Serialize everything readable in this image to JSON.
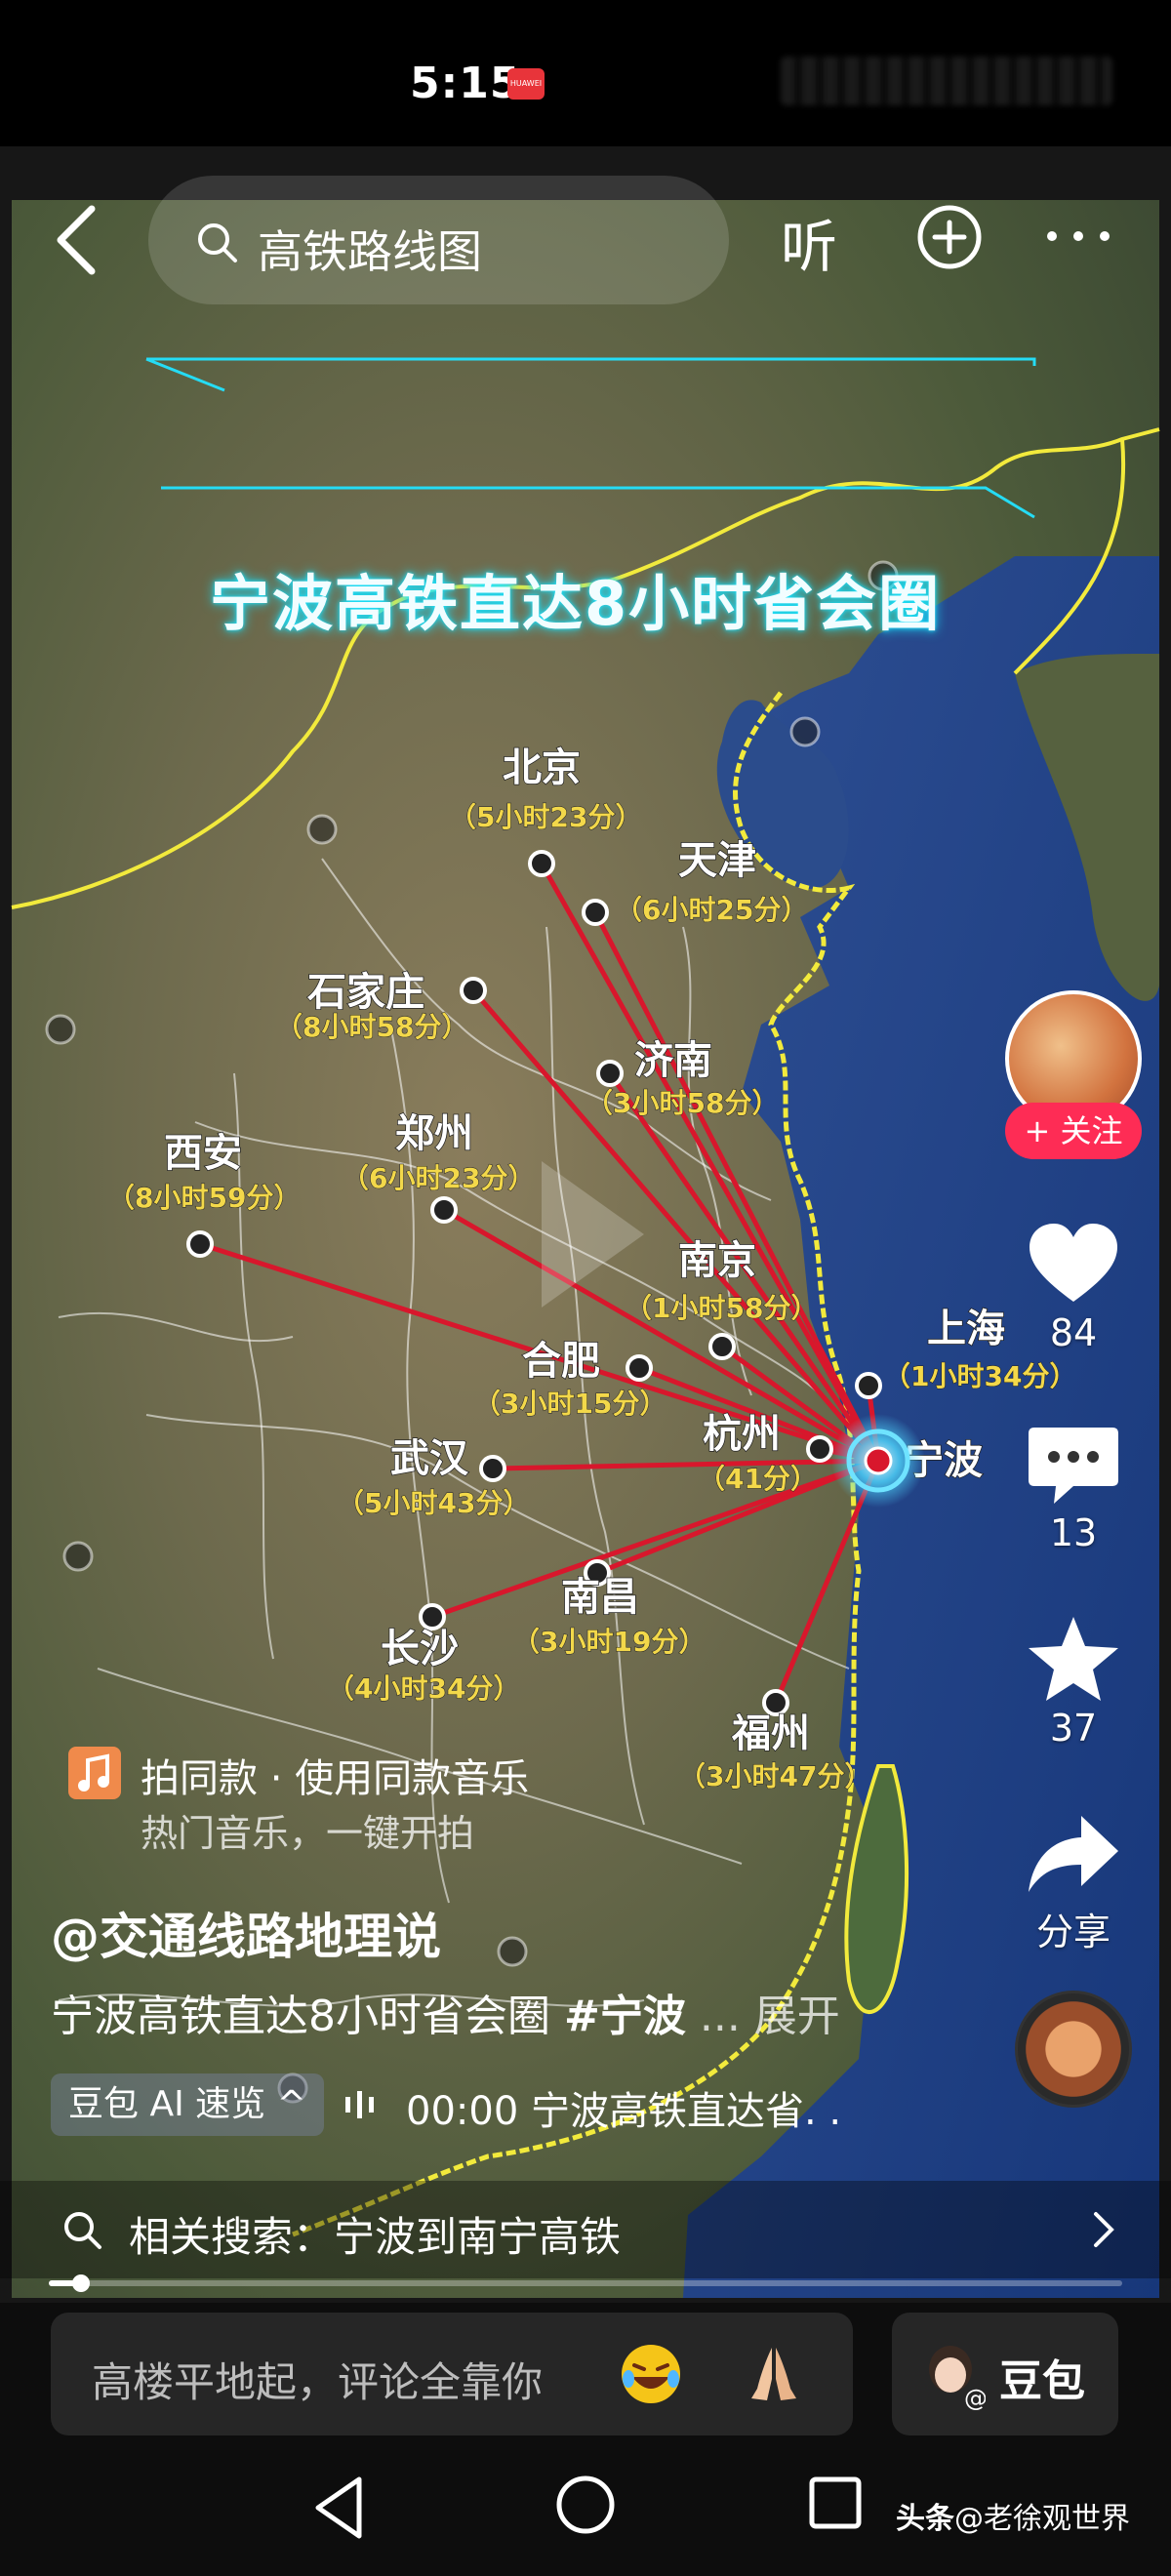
{
  "status_bar": {
    "time": "5:15",
    "badge": "HUAWEI"
  },
  "top_bar": {
    "search_text": "高铁路线图",
    "listen_label": "听"
  },
  "video": {
    "title": "宁波高铁直达8小时省会圈",
    "cities": [
      {
        "name": "北京",
        "time": "（5小时23分）"
      },
      {
        "name": "天津",
        "time": "（6小时25分）"
      },
      {
        "name": "石家庄",
        "time": "（8小时58分）"
      },
      {
        "name": "济南",
        "time": "（3小时58分）"
      },
      {
        "name": "郑州",
        "time": "（6小时23分）"
      },
      {
        "name": "西安",
        "time": "（8小时59分）"
      },
      {
        "name": "南京",
        "time": "（1小时58分）"
      },
      {
        "name": "上海",
        "time": "（1小时34分）"
      },
      {
        "name": "合肥",
        "time": "（3小时15分）"
      },
      {
        "name": "杭州",
        "time": "（41分）"
      },
      {
        "name": "宁波",
        "time": ""
      },
      {
        "name": "武汉",
        "time": "（5小时43分）"
      },
      {
        "name": "南昌",
        "time": "（3小时19分）"
      },
      {
        "name": "长沙",
        "time": "（4小时34分）"
      },
      {
        "name": "福州",
        "time": "（3小时47分）"
      }
    ]
  },
  "side_rail": {
    "follow_label": "+ 关注",
    "likes": "84",
    "comments": "13",
    "favorites": "37",
    "share_label": "分享"
  },
  "same_music": {
    "title": "拍同款 · 使用同款音乐",
    "subtitle": "热门音乐，一键开拍"
  },
  "post": {
    "author": "@交通线路地理说",
    "desc_text": "宁波高铁直达8小时省会圈 ",
    "desc_tag": "#宁波",
    "desc_more": " ... 展开",
    "ai_chip": "豆包 AI 速览 ^",
    "ai_text": "00:00 宁波高铁直达省. ."
  },
  "related": {
    "text": "相关搜索：宁波到南宁高铁"
  },
  "progress": {
    "played_fraction": 0.03
  },
  "comment_bar": {
    "placeholder": "高楼平地起，评论全靠你",
    "doubao_label": "豆包"
  },
  "watermark": {
    "brand": "头条",
    "handle": "@老徐观世界"
  },
  "colors": {
    "route_red": "#d8172c",
    "label_yellow": "#f3d84a",
    "title_glow": "#19e3ff",
    "follow_red": "#fe2c55"
  }
}
